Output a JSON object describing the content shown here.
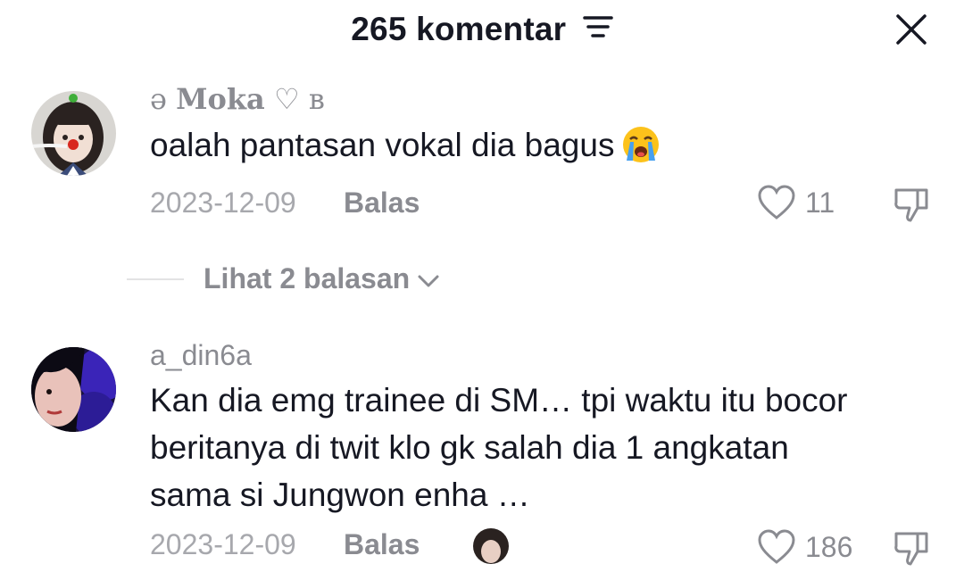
{
  "header": {
    "title": "265 komentar",
    "sort_icon": "sort-icon",
    "close_icon": "close-icon"
  },
  "comments": [
    {
      "username_prefix": "ə",
      "username_bold": "Moka",
      "username_suffix": "♡ ʙ",
      "text": "oalah pantasan vokal dia bagus",
      "emoji": "loudly-crying-face",
      "date": "2023-12-09",
      "reply_label": "Balas",
      "like_count": "11",
      "view_replies": "Lihat 2 balasan"
    },
    {
      "username": "a_din6a",
      "text_lines": [
        "Kan dia emg trainee di SM… tpi waktu itu bocor",
        "beritanya di twit klo gk salah dia 1 angkatan",
        "sama si Jungwon enha …"
      ],
      "date": "2023-12-09",
      "reply_label": "Balas",
      "like_count": "186"
    }
  ],
  "colors": {
    "text_primary": "#161823",
    "text_secondary": "#8a8b91",
    "text_muted": "#a7a8ad"
  }
}
